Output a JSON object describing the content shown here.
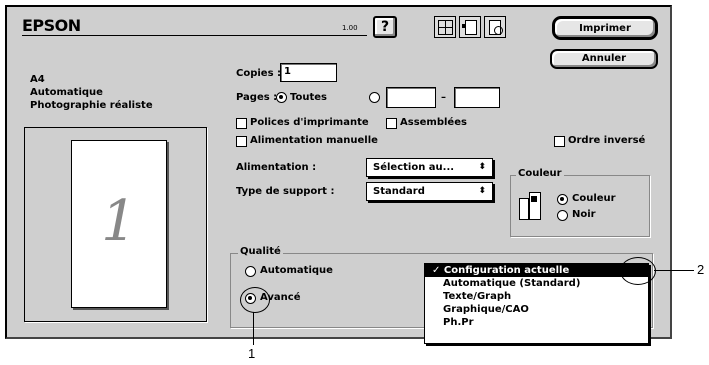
{
  "window": {
    "brand": "EPSON",
    "version": "1.00"
  },
  "toolbar": {
    "help_label": "?",
    "print_label": "Imprimer",
    "cancel_label": "Annuler"
  },
  "paper_info": {
    "size": "A4",
    "mode": "Automatique",
    "quality": "Photographie réaliste",
    "preview_page": "1"
  },
  "copies": {
    "label": "Copies :",
    "value": "1"
  },
  "pages": {
    "label": "Pages :",
    "all_label": "Toutes",
    "dash": "–",
    "from_value": "",
    "to_value": ""
  },
  "options": {
    "printer_fonts_label": "Polices d'imprimante",
    "collate_label": "Assemblées",
    "manual_feed_label": "Alimentation manuelle",
    "reverse_order_label": "Ordre inversé"
  },
  "feed": {
    "label": "Alimentation :",
    "value": "Sélection au..."
  },
  "media": {
    "label": "Type de support :",
    "value": "Standard"
  },
  "color": {
    "title": "Couleur",
    "color_label": "Couleur",
    "black_label": "Noir",
    "selected": "color"
  },
  "quality": {
    "title": "Qualité",
    "auto_label": "Automatique",
    "advanced_label": "Avancé",
    "selected": "advanced",
    "menu": [
      "Configuration actuelle",
      "Automatique (Standard)",
      "Texte/Graph",
      "Graphique/CAO",
      "Ph.Pr"
    ],
    "selected_index": 0
  },
  "callouts": {
    "one": "1",
    "two": "2"
  }
}
